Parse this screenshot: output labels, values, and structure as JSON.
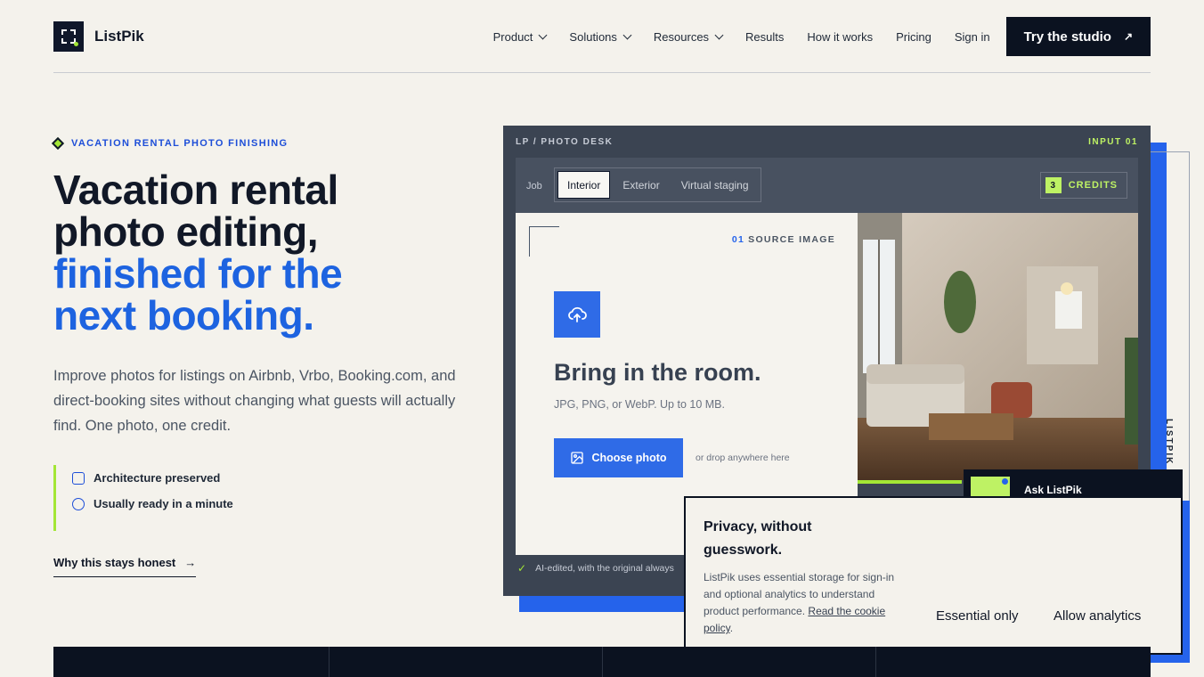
{
  "brand": {
    "name": "ListPik"
  },
  "nav": {
    "items": [
      {
        "label": "Product",
        "dropdown": true
      },
      {
        "label": "Solutions",
        "dropdown": true
      },
      {
        "label": "Resources",
        "dropdown": true
      },
      {
        "label": "Results",
        "dropdown": false
      },
      {
        "label": "How it works",
        "dropdown": false
      },
      {
        "label": "Pricing",
        "dropdown": false
      },
      {
        "label": "Sign in",
        "dropdown": false
      }
    ],
    "cta": "Try the studio"
  },
  "hero": {
    "eyebrow": "VACATION RENTAL PHOTO FINISHING",
    "title_dark_1": "Vacation rental",
    "title_dark_2": "photo editing,",
    "title_blue_1": "finished for the",
    "title_blue_2": "next booking.",
    "lead": "Improve photos for listings on Airbnb, Vrbo, Booking.com, and direct-booking sites without changing what guests will actually find. One photo, one credit.",
    "features": [
      "Architecture preserved",
      "Usually ready in a minute"
    ],
    "link": "Why this stays honest"
  },
  "studio": {
    "label_left": "LP / PHOTO DESK",
    "label_right": "INPUT 01",
    "job_label": "Job",
    "tabs": [
      "Interior",
      "Exterior",
      "Virtual staging"
    ],
    "active_tab": "Interior",
    "credits_count": "3",
    "credits_label": "CREDITS",
    "source_num": "01",
    "source_label": "SOURCE IMAGE",
    "upload_title": "Bring in the room.",
    "upload_sub": "JPG, PNG, or WebP. Up to 10 MB.",
    "choose_label": "Choose photo",
    "drop_hint": "or drop anywhere here",
    "ai_note": "AI-edited, with the original always",
    "side_label": "LISTPIK /",
    "ask_label": "Ask ListPik"
  },
  "cookie": {
    "title": "Privacy, without guesswork.",
    "text": "ListPik uses essential storage for sign-in and optional analytics to understand product performance.",
    "link": "Read the cookie policy",
    "essential": "Essential only",
    "allow": "Allow analytics"
  },
  "colors": {
    "accent_blue": "#2563eb",
    "accent_lime": "#a3e635",
    "ink": "#0b1220",
    "paper": "#f4f2ec"
  }
}
